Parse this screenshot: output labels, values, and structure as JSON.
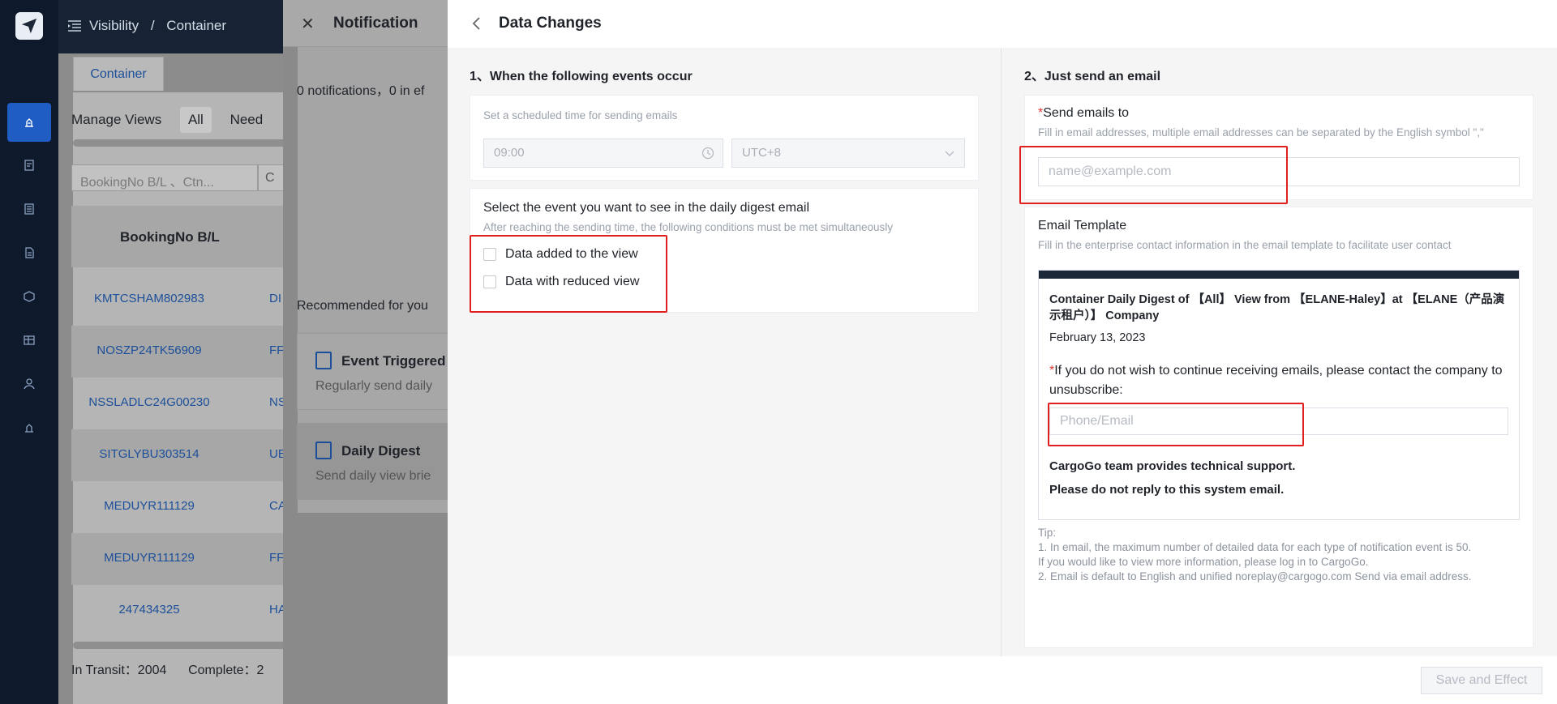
{
  "background": {
    "breadcrumb": [
      "Visibility",
      "/",
      "Container"
    ],
    "tab_container": "Container",
    "view_tabs": [
      "Manage Views",
      "All",
      "Need"
    ],
    "search_placeholder": "BookingNo B/L 、Ctn...",
    "search_suffix": "C",
    "table_header": "BookingNo B/L",
    "rows": [
      {
        "booking": "KMTCSHAM802983",
        "col2": "DI"
      },
      {
        "booking": "NOSZP24TK56909",
        "col2": "FF"
      },
      {
        "booking": "NSSLADLC24G00230",
        "col2": "NS"
      },
      {
        "booking": "SITGLYBU303514",
        "col2": "UE"
      },
      {
        "booking": "MEDUYR111129",
        "col2": "CA"
      },
      {
        "booking": "MEDUYR111129",
        "col2": "FF"
      },
      {
        "booking": "247434325",
        "col2": "HA"
      }
    ],
    "status_transit": "In Transit：2004",
    "status_complete": "Complete：2"
  },
  "notification": {
    "title": "Notification",
    "count_text": "0 notifications，0 in ef",
    "recommended": "Recommended for you",
    "cards": [
      {
        "title": "Event Triggered",
        "desc": "Regularly send daily"
      },
      {
        "title": "Daily Digest",
        "desc": "Send daily view brie"
      }
    ]
  },
  "drawer": {
    "title": "Data Changes",
    "section1_title": "1、When the following events occur",
    "schedule_hint": "Set a scheduled time for sending emails",
    "time_value": "09:00",
    "timezone_value": "UTC+8",
    "event_title": "Select the event you want to see in the daily digest email",
    "event_hint": "After reaching the sending time, the following conditions must be met simultaneously",
    "events": [
      {
        "label": "Data added to the view"
      },
      {
        "label": "Data with reduced view"
      }
    ],
    "section2_title": "2、Just send an email",
    "send_to_required": "*",
    "send_to_label": "Send emails to",
    "send_to_hint": "Fill in email addresses, multiple email addresses can be separated by the English symbol \",\"",
    "email_placeholder": "name@example.com",
    "template_label": "Email Template",
    "template_hint": "Fill in the enterprise contact information in the email template to facilitate user contact",
    "template_title": "Container Daily Digest of 【All】 View from 【ELANE-Haley】at 【ELANE（产品演示租户）】 Company",
    "template_date": "February 13, 2023",
    "unsubscribe_required": "*",
    "unsubscribe_text": "If you do not wish to continue receiving emails, please contact the company to unsubscribe:",
    "phone_placeholder": "Phone/Email",
    "support_text": "CargoGo team provides technical support.",
    "noreply_text": "Please do not reply to this system email.",
    "tips": [
      "Tip:",
      "1. In email, the maximum number of detailed data for each type of notification event is 50.",
      "If you would like to view more information, please log in to CargoGo.",
      "2. Email is default to English and unified noreplay@cargogo.com Send via email address."
    ],
    "save_button": "Save and Effect"
  },
  "colors": {
    "accent": "#1f5dc4",
    "highlight": "#e0201e",
    "required": "#e53935"
  }
}
